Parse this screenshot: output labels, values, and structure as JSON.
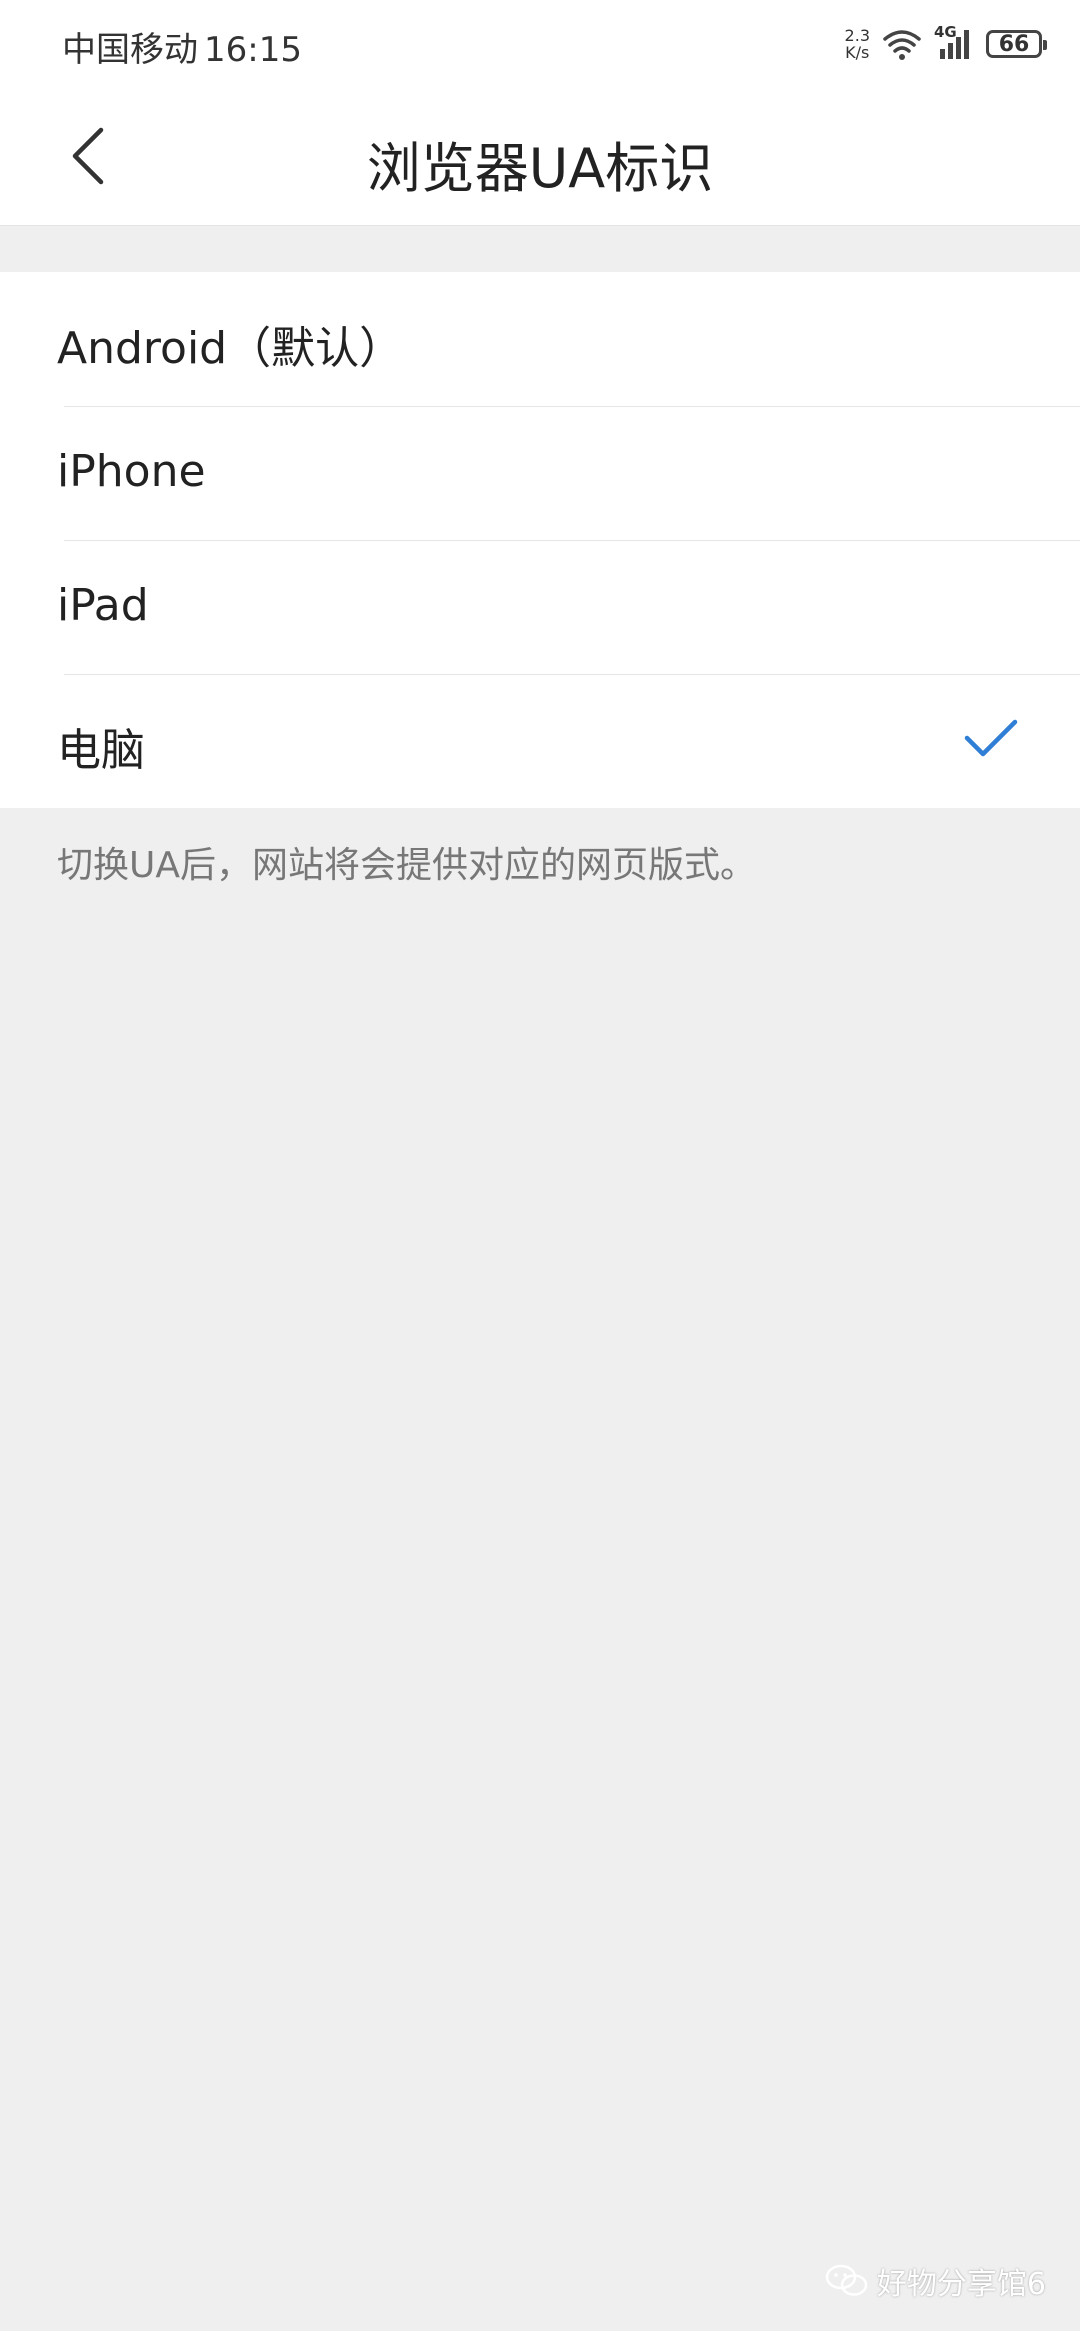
{
  "status_bar": {
    "carrier": "中国移动",
    "time": "16:15",
    "net_speed_value": "2.3",
    "net_speed_unit": "K/s",
    "network_type": "4G",
    "battery_level": "66"
  },
  "header": {
    "title": "浏览器UA标识",
    "back_icon": "chevron-left-icon"
  },
  "ua_options": [
    {
      "label": "Android（默认）",
      "selected": false
    },
    {
      "label": "iPhone",
      "selected": false
    },
    {
      "label": "iPad",
      "selected": false
    },
    {
      "label": "电脑",
      "selected": true
    }
  ],
  "hint": "切换UA后，网站将会提供对应的网页版式。",
  "watermark": "好物分享馆6",
  "colors": {
    "accent": "#2f7fd6",
    "background": "#efefef",
    "surface": "#ffffff"
  }
}
